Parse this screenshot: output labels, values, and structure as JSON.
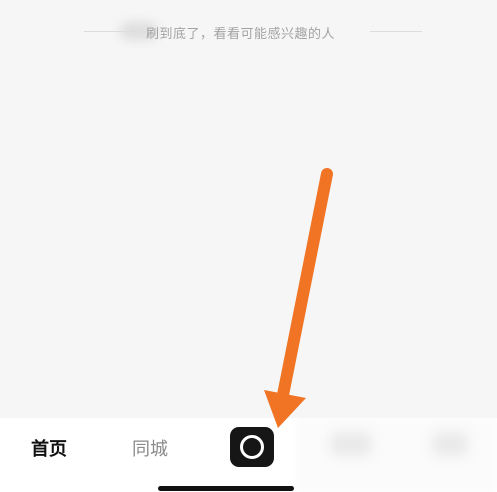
{
  "feed": {
    "end_of_feed_text": "刷到底了，看看可能感兴趣的人"
  },
  "tabbar": {
    "home_label": "首页",
    "city_label": "同城"
  },
  "colors": {
    "annotation_arrow": "#f07424",
    "tab_active": "#111111",
    "tab_inactive": "#8a8a8a",
    "camera_button_bg": "#161616"
  }
}
